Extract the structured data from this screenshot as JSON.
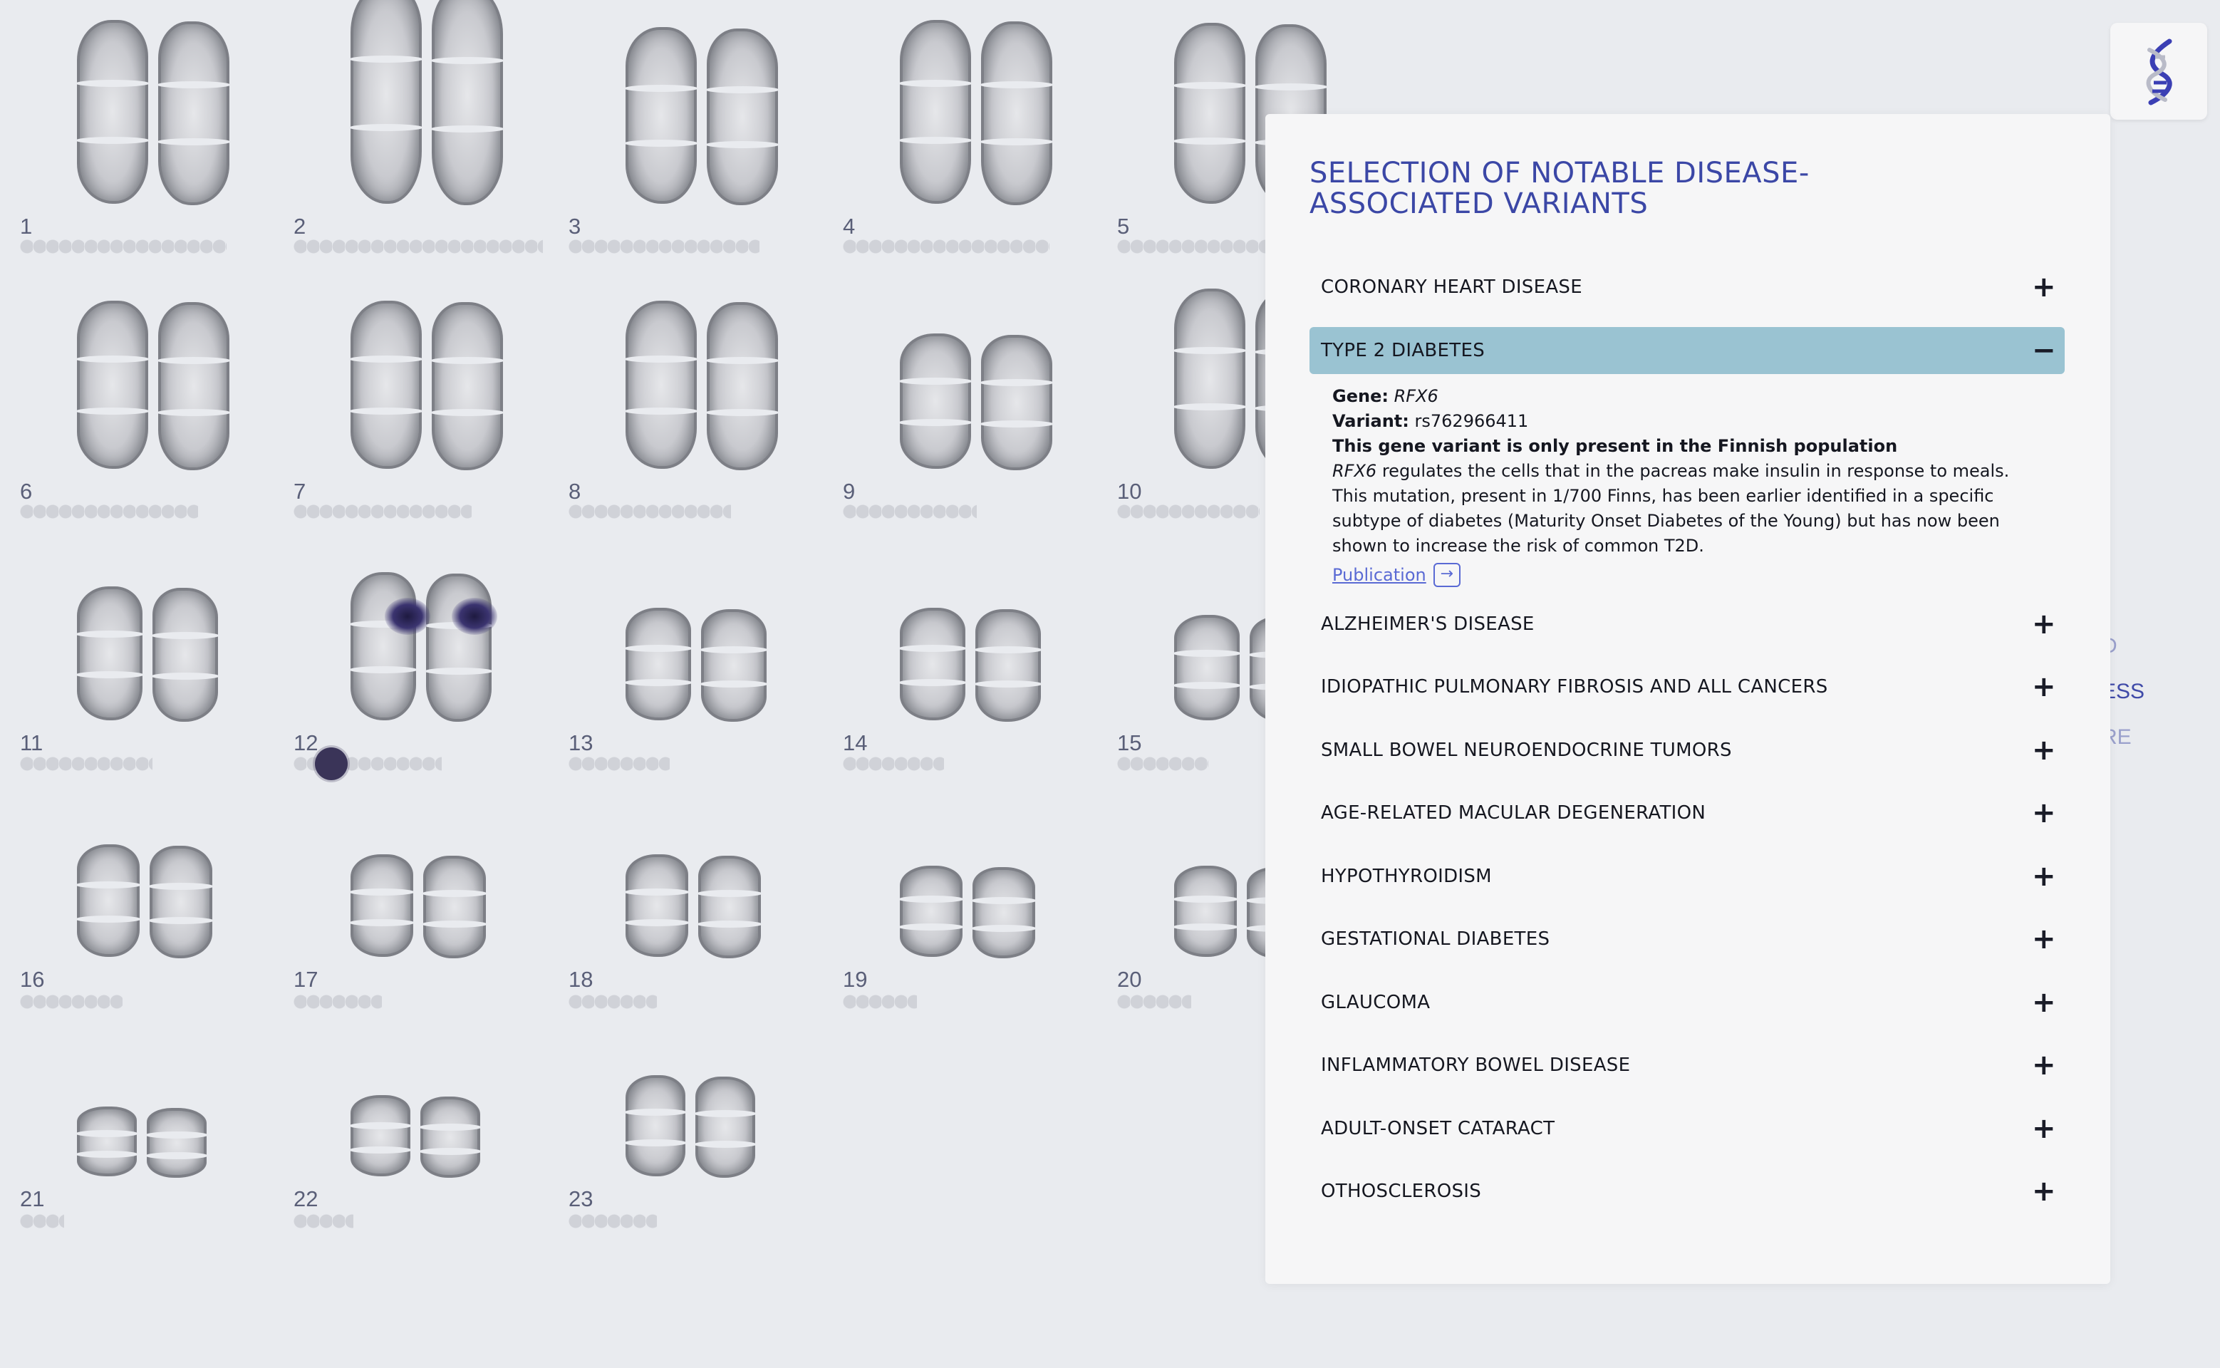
{
  "panel": {
    "title": "SELECTION OF NOTABLE DISEASE-ASSOCIATED VARIANTS",
    "items": [
      {
        "label": "CORONARY HEART DISEASE",
        "toggle": "+"
      },
      {
        "label": "TYPE 2 DIABETES",
        "toggle": "−"
      },
      {
        "label": "ALZHEIMER'S DISEASE",
        "toggle": "+"
      },
      {
        "label": "IDIOPATHIC PULMONARY FIBROSIS AND ALL CANCERS",
        "toggle": "+"
      },
      {
        "label": "SMALL BOWEL NEUROENDOCRINE TUMORS",
        "toggle": "+"
      },
      {
        "label": "AGE-RELATED MACULAR DEGENERATION",
        "toggle": "+"
      },
      {
        "label": "HYPOTHYROIDISM",
        "toggle": "+"
      },
      {
        "label": "GESTATIONAL DIABETES",
        "toggle": "+"
      },
      {
        "label": "GLAUCOMA",
        "toggle": "+"
      },
      {
        "label": "INFLAMMATORY BOWEL DISEASE",
        "toggle": "+"
      },
      {
        "label": "ADULT-ONSET CATARACT",
        "toggle": "+"
      },
      {
        "label": "OTHOSCLEROSIS",
        "toggle": "+"
      }
    ],
    "detail": {
      "gene_label": "Gene:",
      "gene": "RFX6",
      "variant_label": "Variant:",
      "variant": "rs762966411",
      "highlight": "This gene variant is only present in the Finnish population",
      "desc_gene": "RFX6",
      "desc": " regulates the cells that in the pacreas make insulin in response to meals. This mutation, present in 1/700 Finns, has been earlier identified in a specific subtype of diabetes (Maturity Onset Diabetes of the Young) but has now been shown to increase the risk of common T2D.",
      "link": "Publication",
      "link_icon": "→"
    }
  },
  "side_nav": [
    "D",
    "ESS",
    "RE"
  ],
  "logo": "dna-icon",
  "colors": {
    "accent": "#3b47a6",
    "open_row": "#9ac3d2",
    "marker": "#3a3458"
  },
  "chromosomes": [
    "1",
    "2",
    "3",
    "4",
    "5",
    "6",
    "7",
    "8",
    "9",
    "10",
    "11",
    "12",
    "13",
    "14",
    "15",
    "16",
    "17",
    "18",
    "19",
    "20",
    "21",
    "22",
    "23"
  ],
  "highlighted_chromosome": "12"
}
